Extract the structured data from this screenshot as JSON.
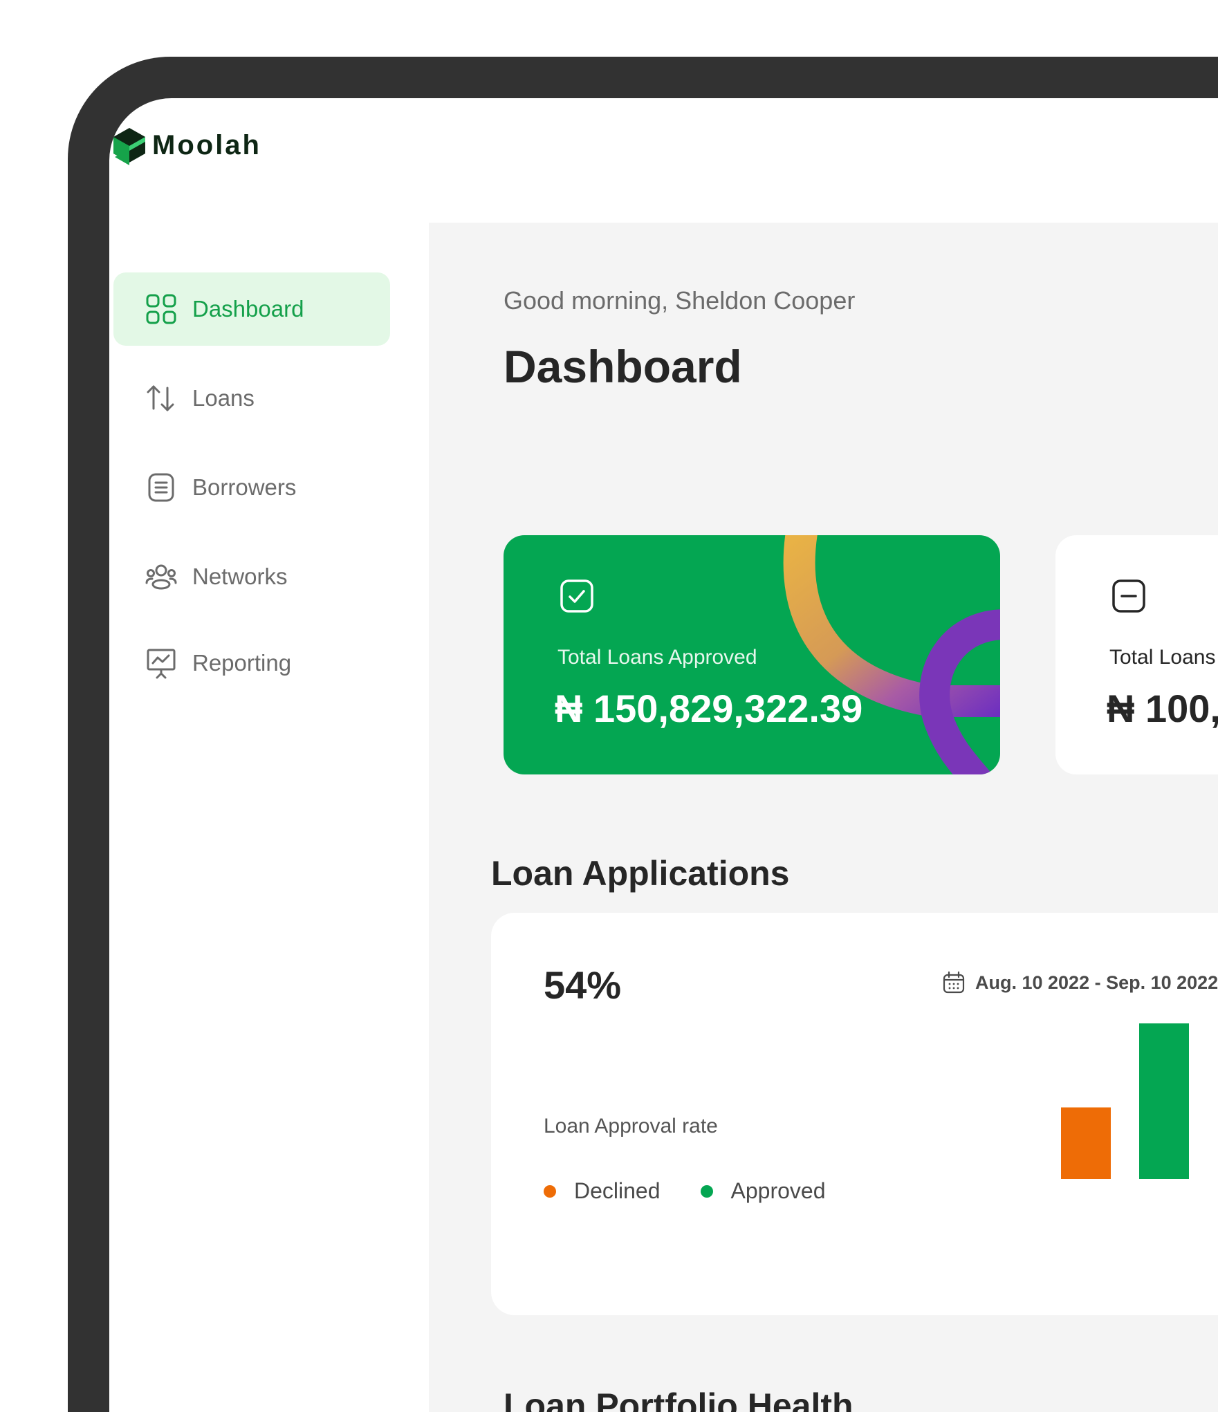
{
  "app": {
    "name": "Moolah"
  },
  "sidebar": {
    "items": [
      {
        "label": "Dashboard",
        "icon": "grid-icon",
        "active": true
      },
      {
        "label": "Loans",
        "icon": "arrows-up-down-icon",
        "active": false
      },
      {
        "label": "Borrowers",
        "icon": "document-list-icon",
        "active": false
      },
      {
        "label": "Networks",
        "icon": "users-group-icon",
        "active": false
      },
      {
        "label": "Reporting",
        "icon": "presentation-chart-icon",
        "active": false
      }
    ]
  },
  "header": {
    "greeting": "Good morning, Sheldon Cooper",
    "title": "Dashboard"
  },
  "cards": [
    {
      "label": "Total Loans Approved",
      "value": "₦ 150,829,322.39",
      "icon": "checkbox-icon"
    },
    {
      "label": "Total Loans",
      "value": "₦ 100,",
      "icon": "minus-square-icon"
    }
  ],
  "loan_applications": {
    "title": "Loan Applications",
    "rate": "54%",
    "rate_label": "Loan Approval rate",
    "date_range": "Aug. 10 2022 - Sep. 10 2022",
    "legend": [
      {
        "label": "Declined",
        "color": "#ee6c06"
      },
      {
        "label": "Approved",
        "color": "#04a652"
      }
    ]
  },
  "chart_data": {
    "type": "bar",
    "categories": [
      "Declined",
      "Approved"
    ],
    "values": [
      46,
      100
    ],
    "ylim": [
      0,
      100
    ]
  },
  "portfolio": {
    "title": "Loan Portfolio Health"
  },
  "colors": {
    "brand_green": "#04a652",
    "declined_orange": "#ee6c06",
    "frame_dark": "#323232"
  }
}
